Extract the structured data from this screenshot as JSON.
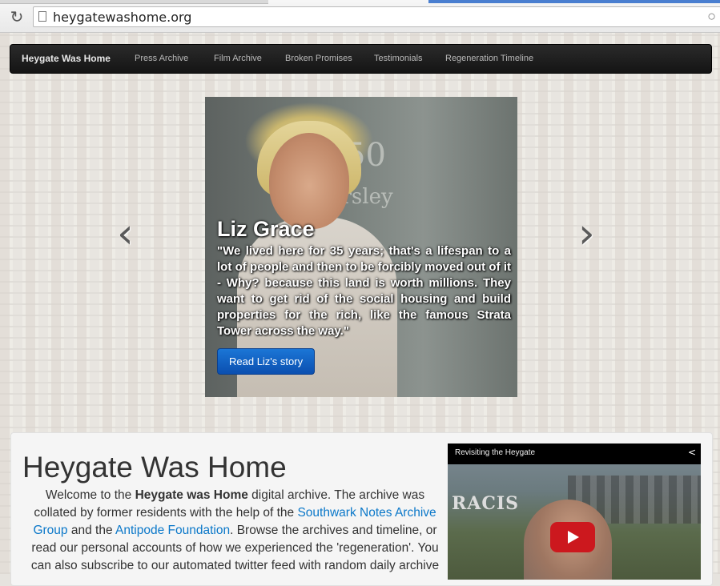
{
  "browser": {
    "url": "heygatewashome.org"
  },
  "nav": {
    "brand": "Heygate Was Home",
    "items": [
      "Press Archive",
      "Film Archive",
      "Broken Promises",
      "Testimonials",
      "Regeneration Timeline"
    ]
  },
  "carousel": {
    "title": "Liz Grace",
    "quote": "\"We lived here for 35 years; that's a lifespan to a lot of people and then to be forcibly moved out of it - Why? because this land is worth millions. They want to get rid of the social housing and build properties for the rich, like the famous Strata Tower across the way.\"",
    "button": "Read Liz's story",
    "prev": "‹",
    "next": "›"
  },
  "main": {
    "heading": "Heygate Was Home",
    "intro": {
      "p1": "Welcome to the ",
      "bold": "Heygate was Home",
      "p2": " digital archive. The archive was collated by former residents with the help of the ",
      "link1": "Southwark Notes Archive Group",
      "p3": " and the ",
      "link2": "Antipode Foundation",
      "p4": ". Browse the archives and timeline, or read our personal accounts of how we experienced the 'regeneration'. You can also subscribe to our automated twitter feed with random daily archive"
    }
  },
  "video": {
    "title": "Revisiting the Heygate",
    "graffiti": "RACIS"
  },
  "colors": {
    "navbar": "#1b1b1b",
    "button": "#0b5fc4",
    "link": "#0b78c9",
    "youtube": "#cc181e"
  }
}
